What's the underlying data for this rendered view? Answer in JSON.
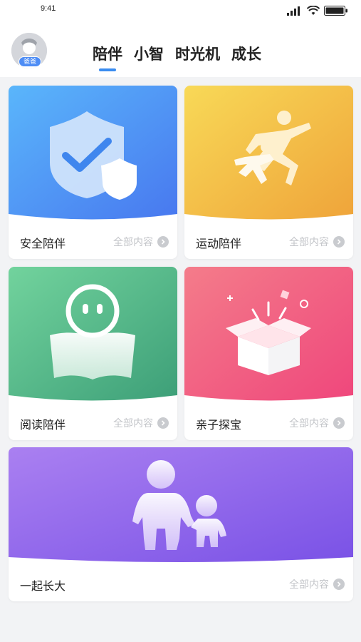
{
  "status_bar": {
    "time": "9:41",
    "icons": [
      "signal-icon",
      "wifi-icon",
      "battery-icon"
    ]
  },
  "header": {
    "avatar_badge": "爸爸",
    "tabs": [
      {
        "label": "陪伴",
        "active": true
      },
      {
        "label": "小智",
        "active": false
      },
      {
        "label": "时光机",
        "active": false
      },
      {
        "label": "成长",
        "active": false
      }
    ],
    "accent_color": "#3a8cf0"
  },
  "cards": [
    {
      "title": "安全陪伴",
      "more": "全部内容",
      "icon": "shield-check-icon",
      "colors": [
        "#58b4fb",
        "#4a7bf0"
      ]
    },
    {
      "title": "运动陪伴",
      "more": "全部内容",
      "icon": "running-icon",
      "colors": [
        "#f7d653",
        "#f0a63a"
      ]
    },
    {
      "title": "阅读陪伴",
      "more": "全部内容",
      "icon": "reading-icon",
      "colors": [
        "#6fd09a",
        "#3fa27a"
      ]
    },
    {
      "title": "亲子探宝",
      "more": "全部内容",
      "icon": "gift-box-icon",
      "colors": [
        "#f47a8a",
        "#f04a7c"
      ]
    },
    {
      "title": "一起长大",
      "more": "全部内容",
      "icon": "parent-child-icon",
      "colors": [
        "#a97df0",
        "#7b55e8"
      ]
    }
  ]
}
